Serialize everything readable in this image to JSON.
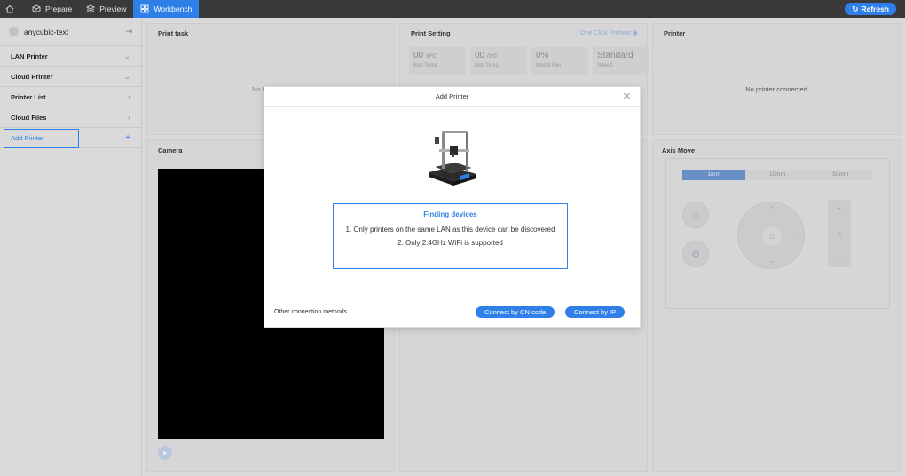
{
  "topbar": {
    "tabs": [
      {
        "label": "Prepare",
        "icon": "cube-icon"
      },
      {
        "label": "Preview",
        "icon": "layers-icon"
      },
      {
        "label": "Workbench",
        "icon": "grid-icon",
        "active": true
      }
    ],
    "refresh_label": "Refresh"
  },
  "sidebar": {
    "user_name": "anycubic-text",
    "items": [
      {
        "label": "LAN Printer",
        "icon": "chevron-down-icon"
      },
      {
        "label": "Cloud Printer",
        "icon": "chevron-down-icon"
      },
      {
        "label": "Printer List",
        "icon": "chevron-right-icon"
      },
      {
        "label": "Cloud Files",
        "icon": "chevron-right-icon"
      },
      {
        "label": "Add Printer",
        "icon": "plus-icon"
      }
    ]
  },
  "panels": {
    "print_task": {
      "title": "Print task",
      "empty_text": "No Pr"
    },
    "print_setting": {
      "title": "Print Setting",
      "link": "One Click Preheat",
      "stats": [
        {
          "value": "00",
          "unit": "/0°C",
          "label": "Bed Temp"
        },
        {
          "value": "00",
          "unit": "/0°C",
          "label": "Noz Temp"
        },
        {
          "value": "0%",
          "unit": "",
          "label": "Model Fan"
        },
        {
          "value": "Standard",
          "unit": "",
          "label": "Speed"
        }
      ]
    },
    "printer": {
      "title": "Printer",
      "empty_text": "No printer connected"
    },
    "camera": {
      "title": "Camera"
    },
    "axis_move": {
      "title": "Axis Move",
      "steps": [
        "1mm",
        "15mm",
        "50mm"
      ],
      "active_step": 0
    }
  },
  "modal": {
    "title": "Add Printer",
    "finding_title": "Finding devices",
    "lines": [
      "1. Only printers on the same LAN as this device can be discovered",
      "2. Only 2.4GHz WiFi is supported"
    ],
    "other_methods": "Other connection methods",
    "btn_cn": "Connect by CN code",
    "btn_ip": "Connect by IP"
  },
  "colors": {
    "accent": "#2f7fe8",
    "topbar": "#3a3a3a"
  }
}
